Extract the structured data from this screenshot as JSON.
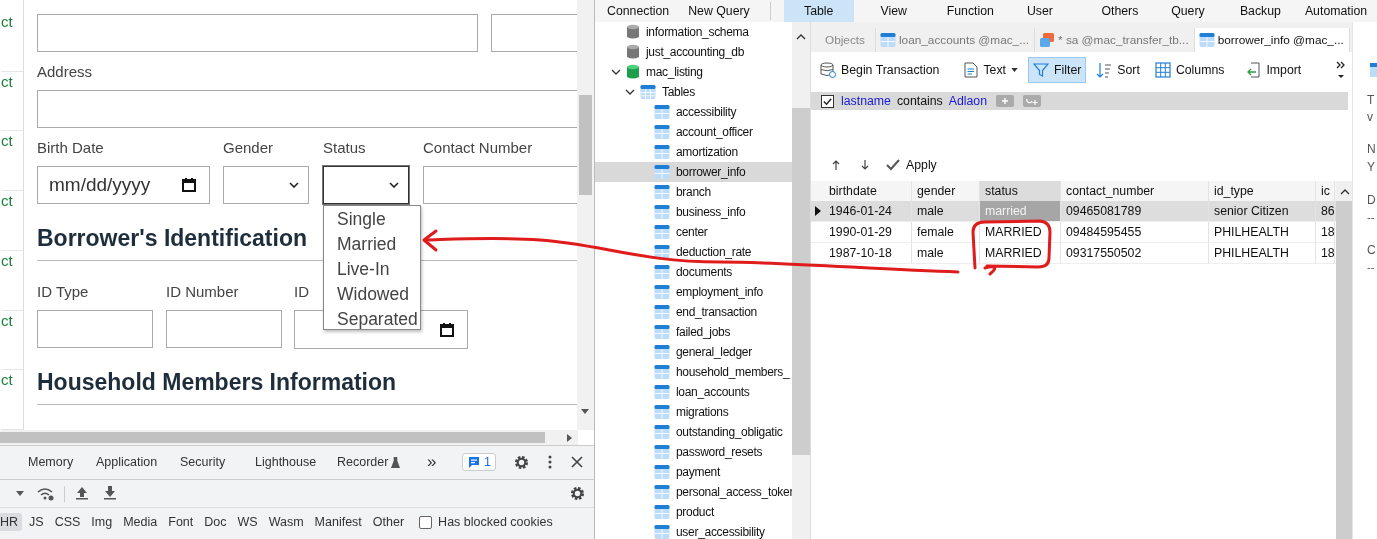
{
  "browser": {
    "sidebar_fragments": [
      "ct",
      "ct",
      "ct",
      "ct",
      "ct",
      "ct",
      "ct"
    ],
    "form": {
      "address_label": "Address",
      "personal_fields": [
        {
          "label": "Birth Date",
          "kind": "date",
          "placeholder": "mm/dd/yyyy"
        },
        {
          "label": "Gender",
          "kind": "select",
          "open": false
        },
        {
          "label": "Status",
          "kind": "select",
          "open": true
        },
        {
          "label": "Contact Number",
          "kind": "text"
        }
      ],
      "id_heading": "Borrower's Identification",
      "id_fields": [
        {
          "label": "ID Type",
          "kind": "text"
        },
        {
          "label": "ID Number",
          "kind": "text"
        },
        {
          "label": "ID",
          "kind": "date"
        }
      ],
      "household_heading": "Household Members Information",
      "status_options": [
        {
          "label": "Single",
          "selected": false
        },
        {
          "label": "Married",
          "selected": false
        },
        {
          "label": "Live-In",
          "selected": false
        },
        {
          "label": "Widowed",
          "selected": false
        },
        {
          "label": "Separated",
          "selected": false
        }
      ]
    }
  },
  "devtools": {
    "tabs": [
      {
        "label": "Memory",
        "selected": false
      },
      {
        "label": "Application",
        "selected": false
      },
      {
        "label": "Security",
        "selected": false
      },
      {
        "label": "Lighthouse",
        "selected": false
      },
      {
        "label": "Recorder",
        "selected": false
      }
    ],
    "more": "»",
    "issues_count": "1",
    "filters": [
      {
        "label": "HR",
        "selected": true
      },
      {
        "label": "JS",
        "selected": false
      },
      {
        "label": "CSS",
        "selected": false
      },
      {
        "label": "Img",
        "selected": false
      },
      {
        "label": "Media",
        "selected": false
      },
      {
        "label": "Font",
        "selected": false
      },
      {
        "label": "Doc",
        "selected": false
      },
      {
        "label": "WS",
        "selected": false
      },
      {
        "label": "Wasm",
        "selected": false
      },
      {
        "label": "Manifest",
        "selected": false
      },
      {
        "label": "Other",
        "selected": false
      }
    ],
    "blocked_cookies": {
      "label": "Has blocked cookies",
      "checked": false
    }
  },
  "navicat": {
    "menu": [
      "Connection",
      "New Query"
    ],
    "ribbon_tabs": [
      {
        "label": "Table",
        "selected": true
      },
      {
        "label": "View",
        "selected": false
      },
      {
        "label": "Function",
        "selected": false
      },
      {
        "label": "User",
        "selected": false
      },
      {
        "label": "Others",
        "selected": false
      },
      {
        "label": "Query",
        "selected": false
      },
      {
        "label": "Backup",
        "selected": false
      },
      {
        "label": "Automation",
        "selected": false
      }
    ],
    "tree": [
      {
        "label": "information_schema",
        "kind": "database",
        "expanded": false,
        "selected": false
      },
      {
        "label": "just_accounting_db",
        "kind": "database",
        "expanded": false,
        "selected": false
      },
      {
        "label": "mac_listing",
        "kind": "database",
        "expanded": true,
        "selected": false,
        "children": [
          {
            "label": "Tables",
            "kind": "folder",
            "expanded": true,
            "selected": false,
            "children": [
              {
                "label": "accessibility",
                "kind": "table",
                "selected": false
              },
              {
                "label": "account_officer",
                "kind": "table",
                "selected": false
              },
              {
                "label": "amortization",
                "kind": "table",
                "selected": false
              },
              {
                "label": "borrower_info",
                "kind": "table",
                "selected": true
              },
              {
                "label": "branch",
                "kind": "table",
                "selected": false
              },
              {
                "label": "business_info",
                "kind": "table",
                "selected": false
              },
              {
                "label": "center",
                "kind": "table",
                "selected": false
              },
              {
                "label": "deduction_rate",
                "kind": "table",
                "selected": false
              },
              {
                "label": "documents",
                "kind": "table",
                "selected": false
              },
              {
                "label": "employment_info",
                "kind": "table",
                "selected": false
              },
              {
                "label": "end_transaction",
                "kind": "table",
                "selected": false
              },
              {
                "label": "failed_jobs",
                "kind": "table",
                "selected": false
              },
              {
                "label": "general_ledger",
                "kind": "table",
                "selected": false
              },
              {
                "label": "household_members_",
                "kind": "table",
                "selected": false
              },
              {
                "label": "loan_accounts",
                "kind": "table",
                "selected": false
              },
              {
                "label": "migrations",
                "kind": "table",
                "selected": false
              },
              {
                "label": "outstanding_obligatic",
                "kind": "table",
                "selected": false
              },
              {
                "label": "password_resets",
                "kind": "table",
                "selected": false
              },
              {
                "label": "payment",
                "kind": "table",
                "selected": false
              },
              {
                "label": "personal_access_toker",
                "kind": "table",
                "selected": false
              },
              {
                "label": "product",
                "kind": "table",
                "selected": false
              },
              {
                "label": "user_accessibility",
                "kind": "table",
                "selected": false
              }
            ]
          }
        ]
      }
    ],
    "editor_tabs": [
      {
        "label": "Objects",
        "kind": "objects",
        "selected": false
      },
      {
        "label": "loan_accounts @mac_...",
        "kind": "table",
        "selected": false
      },
      {
        "label": "* sa @mac_transfer_tb...",
        "kind": "query",
        "selected": false
      },
      {
        "label": "borrower_info @mac_...",
        "kind": "table",
        "selected": true
      }
    ],
    "toolbar": [
      {
        "label": "Begin Transaction",
        "kind": "transaction",
        "on": false
      },
      {
        "label": "Text",
        "kind": "text",
        "on": false
      },
      {
        "label": "Filter",
        "kind": "filter",
        "on": true
      },
      {
        "label": "Sort",
        "kind": "sort",
        "on": false
      },
      {
        "label": "Columns",
        "kind": "columns",
        "on": false
      },
      {
        "label": "Import",
        "kind": "import",
        "on": false
      }
    ],
    "filter": {
      "checked": true,
      "field": "lastname",
      "operator": "contains",
      "value": "Adlaon"
    },
    "apply_label": "Apply",
    "table": {
      "columns": [
        {
          "label": "birthdate",
          "selected": false
        },
        {
          "label": "gender",
          "selected": false
        },
        {
          "label": "status",
          "selected": true
        },
        {
          "label": "contact_number",
          "selected": false
        },
        {
          "label": "id_type",
          "selected": false
        },
        {
          "label": "ic",
          "selected": false
        }
      ],
      "rows": [
        {
          "selected": true,
          "cells": [
            "1946-01-24",
            "male",
            "married",
            "09465081789",
            "senior Citizen",
            "86"
          ]
        },
        {
          "selected": false,
          "cells": [
            "1990-01-29",
            "female",
            "MARRIED",
            "09484595455",
            "PHILHEALTH",
            "18"
          ]
        },
        {
          "selected": false,
          "cells": [
            "1987-10-18",
            "male",
            "MARRIED",
            "09317550502",
            "PHILHEALTH",
            "18"
          ]
        }
      ]
    },
    "properties_fragments": [
      "T",
      "v",
      "N",
      "Y",
      "D",
      "--",
      "C",
      "--"
    ]
  }
}
